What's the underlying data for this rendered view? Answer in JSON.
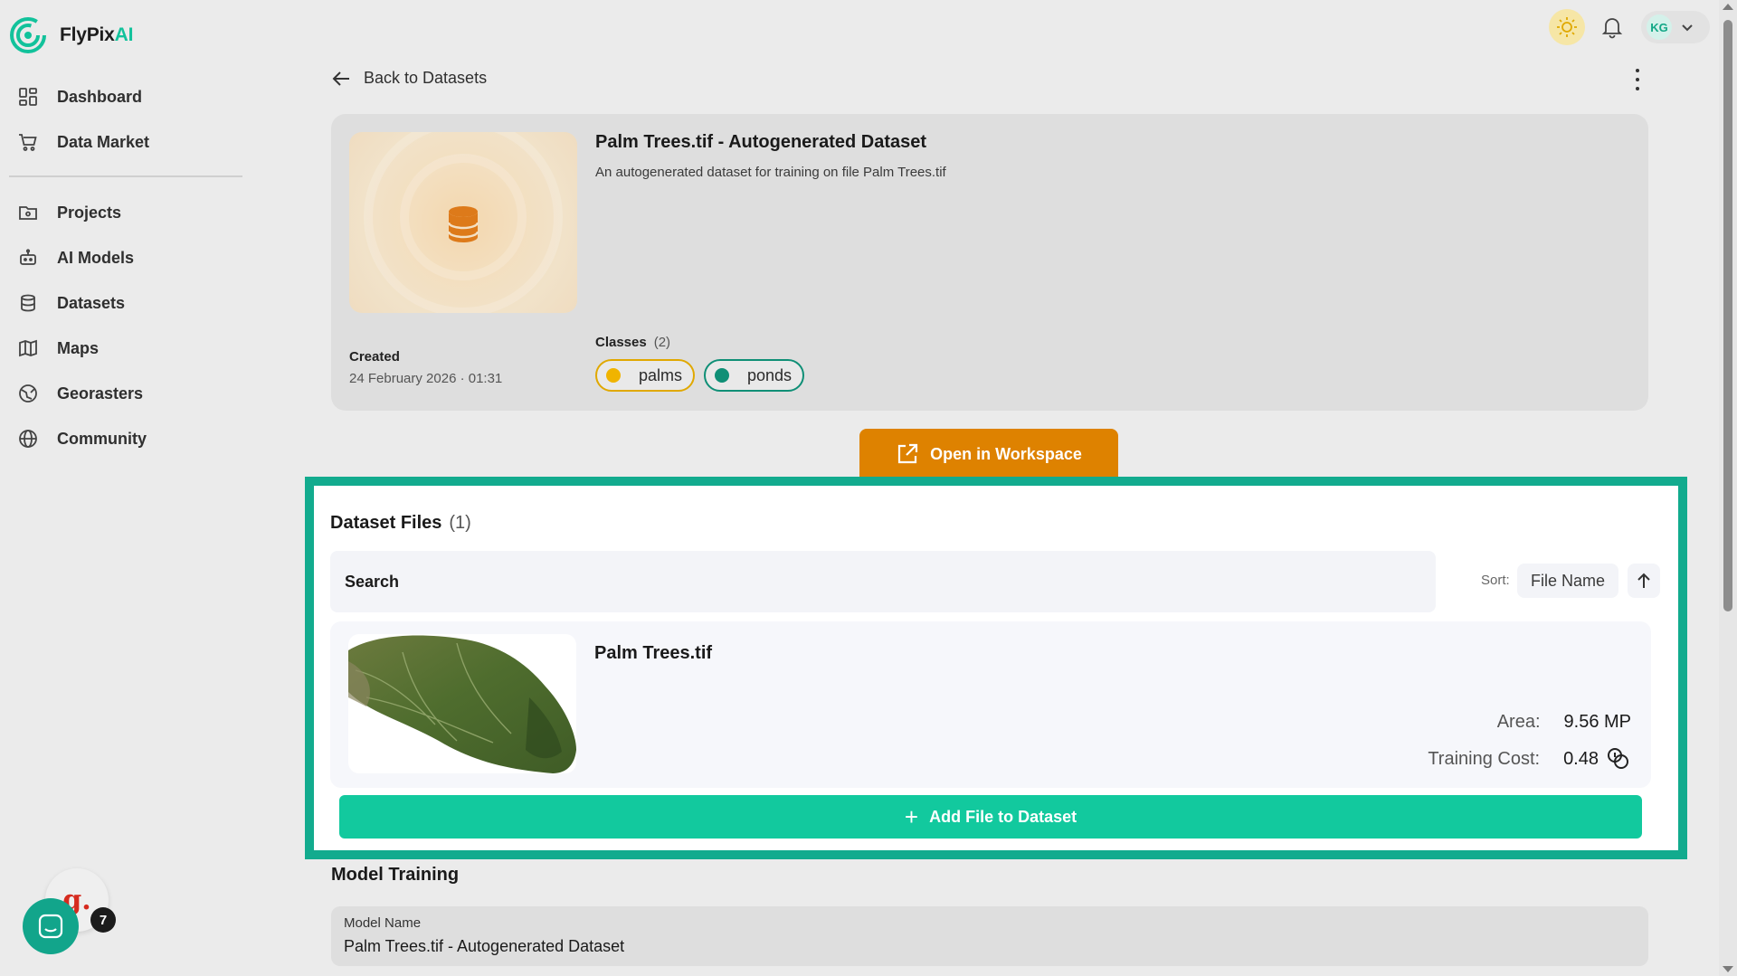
{
  "app": {
    "name_prefix": "FlyPix",
    "name_suffix": "AI",
    "accent_color": "#12c29b"
  },
  "sidebar": {
    "items_top": [
      {
        "label": "Dashboard",
        "icon": "dashboard-icon"
      },
      {
        "label": "Data Market",
        "icon": "cart-icon"
      }
    ],
    "items_bottom": [
      {
        "label": "Projects",
        "icon": "folder-icon"
      },
      {
        "label": "AI Models",
        "icon": "robot-icon"
      },
      {
        "label": "Datasets",
        "icon": "database-icon"
      },
      {
        "label": "Maps",
        "icon": "map-icon"
      },
      {
        "label": "Georasters",
        "icon": "georaster-icon"
      },
      {
        "label": "Community",
        "icon": "globe-icon"
      }
    ]
  },
  "header": {
    "user_initials": "KG",
    "theme_icon": "sun-icon",
    "notifications_icon": "bell-icon"
  },
  "page": {
    "back_label": "Back to Datasets",
    "dataset": {
      "title": "Palm Trees.tif - Autogenerated Dataset",
      "description": "An autogenerated dataset for training on file Palm Trees.tif",
      "created_label": "Created",
      "created_value": "24 February 2026 · 01:31",
      "classes_label": "Classes",
      "classes_count": "(2)",
      "classes": [
        {
          "name": "palms",
          "color": "#f0b400",
          "border": "#e0a800"
        },
        {
          "name": "ponds",
          "color": "#0f8f76",
          "border": "#0f8f76"
        }
      ]
    },
    "open_workspace_label": "Open in Workspace",
    "files": {
      "title": "Dataset Files",
      "count": "(1)",
      "search_placeholder": "Search",
      "sort_label": "Sort:",
      "sort_value": "File Name",
      "items": [
        {
          "name": "Palm Trees.tif",
          "area_label": "Area:",
          "area_value": "9.56 MP",
          "cost_label": "Training Cost:",
          "cost_value": "0.48"
        }
      ],
      "add_label": "Add File to Dataset",
      "highlight_color": "#12ab8e"
    },
    "model_training": {
      "title": "Model Training",
      "model_name_label": "Model Name",
      "model_name_value": "Palm Trees.tif - Autogenerated Dataset"
    }
  },
  "widgets": {
    "g_badge": "g.",
    "notification_count": "7"
  }
}
